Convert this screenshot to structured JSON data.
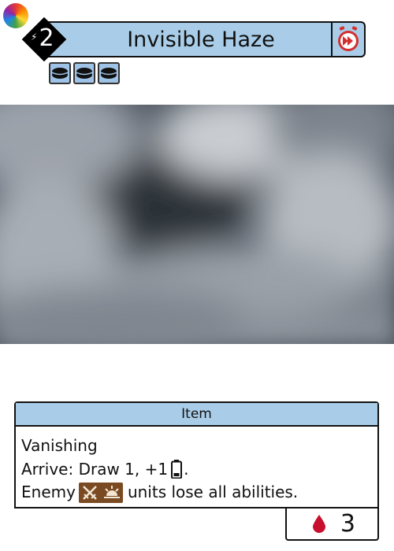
{
  "card": {
    "title": "Invisible Haze",
    "cost": "2",
    "type": "Item",
    "rules": {
      "line1": "Vanishing",
      "line2_pre": "Arrive: Draw 1, +1",
      "line2_post": ".",
      "line3_pre": "Enemy",
      "line3_post": "units lose all abilities."
    },
    "footer": {
      "count": "3",
      "icon": "blood-drop-icon"
    },
    "token_count": 3,
    "icons": {
      "top_left": "color-wheel-icon",
      "cost_bolt": "lightning-icon",
      "speed": "fast-forward-clock-icon",
      "tokens": "disc-icon",
      "energy": "battery-icon",
      "traits": [
        "crossed-swords-icon",
        "sunrise-icon"
      ]
    },
    "colors": {
      "frame": "#a9cde8",
      "token": "#9fc3e6",
      "speed": "#d32f2f",
      "blood": "#c8102e",
      "trait": "#7a4a22"
    }
  }
}
